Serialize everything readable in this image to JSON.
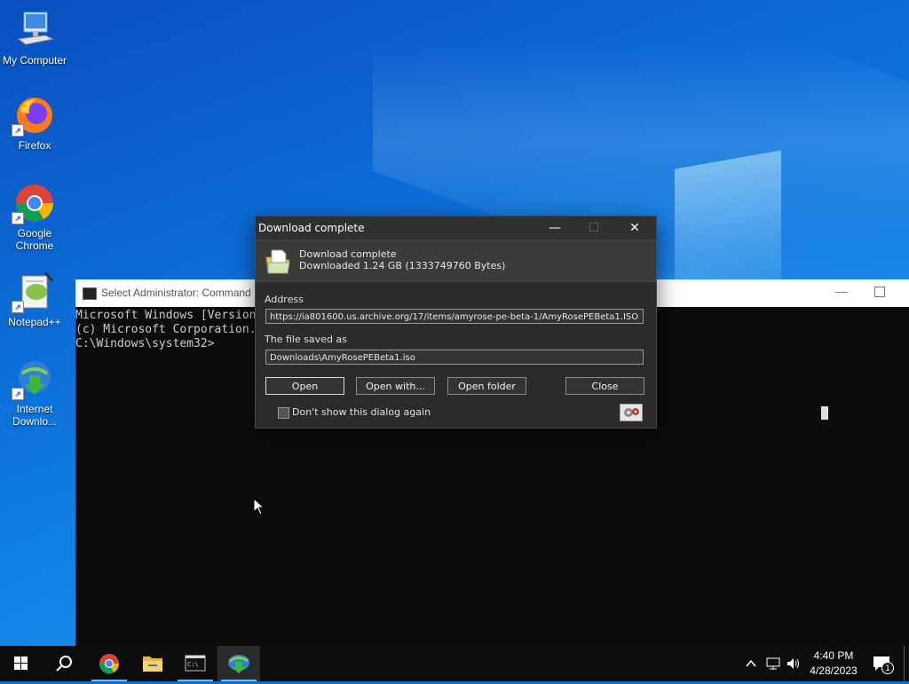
{
  "desktop": {
    "icons": [
      {
        "label": "My Computer"
      },
      {
        "label": "Firefox"
      },
      {
        "label": "Google Chrome"
      },
      {
        "label": "Notepad++"
      },
      {
        "label": "Internet Downlo..."
      }
    ]
  },
  "cmd": {
    "title": "Select Administrator: Command Prompt",
    "lines": [
      "Microsoft Windows [Version 10.0.17763.737]",
      "(c) Microsoft Corporation. All rights reserved.",
      "",
      "C:\\Windows\\system32>"
    ],
    "minimize_glyph": "—"
  },
  "dialog": {
    "title": "Download complete",
    "header_line1": "Download complete",
    "header_line2": "Downloaded 1.24 GB (1333749760 Bytes)",
    "address_label": "Address",
    "address_value": "https://ia801600.us.archive.org/17/items/amyrose-pe-beta-1/AmyRosePEBeta1.ISO",
    "saved_label": "The file saved as",
    "saved_value": "Downloads\\AmyRosePEBeta1.iso",
    "buttons": {
      "open": "Open",
      "open_with": "Open with...",
      "open_folder": "Open folder",
      "close": "Close"
    },
    "checkbox_label": "Don't show this dialog again",
    "title_buttons": {
      "minimize": "—",
      "maximize": "☐",
      "close": "✕"
    }
  },
  "taskbar": {
    "time": "4:40 PM",
    "date": "4/28/2023",
    "notification_count": "1",
    "icons": [
      "windows-start-icon",
      "search-icon",
      "chrome-icon",
      "file-explorer-icon",
      "command-prompt-icon",
      "internet-download-manager-icon"
    ]
  },
  "colors": {
    "accent": "#0b6fd0",
    "taskbar": "#0d0d0d",
    "dialog_bg": "#2b2b2b"
  }
}
